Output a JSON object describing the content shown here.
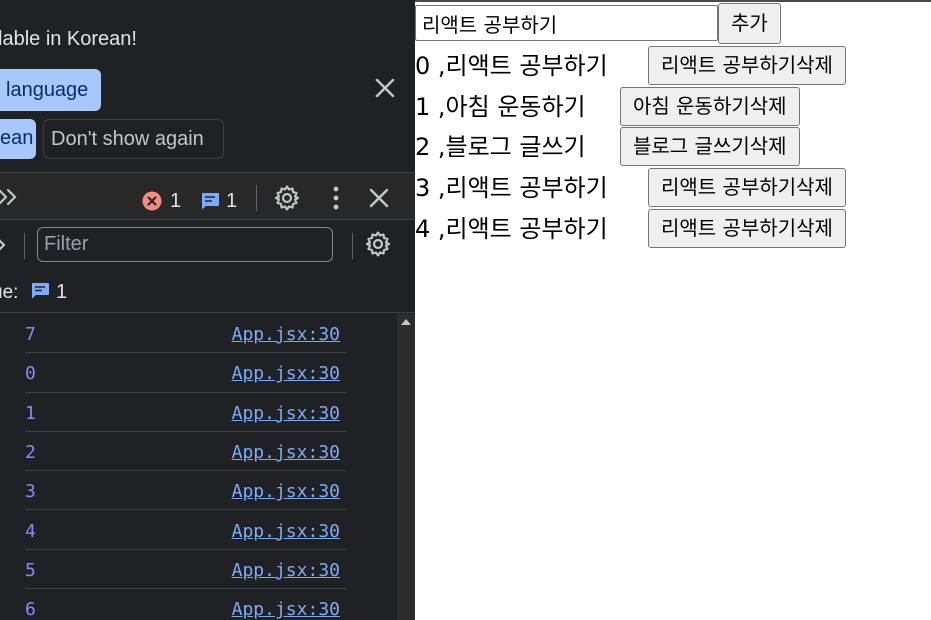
{
  "devtools": {
    "banner": {
      "text": "lable in Korean!",
      "switch_language_label": "language",
      "korean_label": "ean",
      "dont_show_label": "Don't show again"
    },
    "toolbar": {
      "error_count": "1",
      "message_count": "1"
    },
    "filter": {
      "placeholder": "Filter"
    },
    "issues": {
      "label": "ue:",
      "count": "1"
    },
    "log_rows": [
      {
        "value": "7",
        "source": "App.jsx:30"
      },
      {
        "value": "0",
        "source": "App.jsx:30"
      },
      {
        "value": "1",
        "source": "App.jsx:30"
      },
      {
        "value": "2",
        "source": "App.jsx:30"
      },
      {
        "value": "3",
        "source": "App.jsx:30"
      },
      {
        "value": "4",
        "source": "App.jsx:30"
      },
      {
        "value": "5",
        "source": "App.jsx:30"
      },
      {
        "value": "6",
        "source": "App.jsx:30"
      }
    ],
    "colors": {
      "background": "#202124",
      "accent_button": "#a8c7fa",
      "log_value": "#9980ff",
      "log_link": "#7cacf8",
      "error": "#f28b82",
      "message": "#7cacf8"
    }
  },
  "app": {
    "input_value": "리액트 공부하기",
    "add_button_label": "추가",
    "todos": [
      {
        "text": "0 ,리액트 공부하기",
        "button_label": "리액트 공부하기삭제"
      },
      {
        "text": "1 ,아침 운동하기",
        "button_label": "아침 운동하기삭제"
      },
      {
        "text": "2 ,블로그 글쓰기",
        "button_label": "블로그 글쓰기삭제"
      },
      {
        "text": "3 ,리액트 공부하기",
        "button_label": "리액트 공부하기삭제"
      },
      {
        "text": "4 ,리액트 공부하기",
        "button_label": "리액트 공부하기삭제"
      }
    ]
  }
}
